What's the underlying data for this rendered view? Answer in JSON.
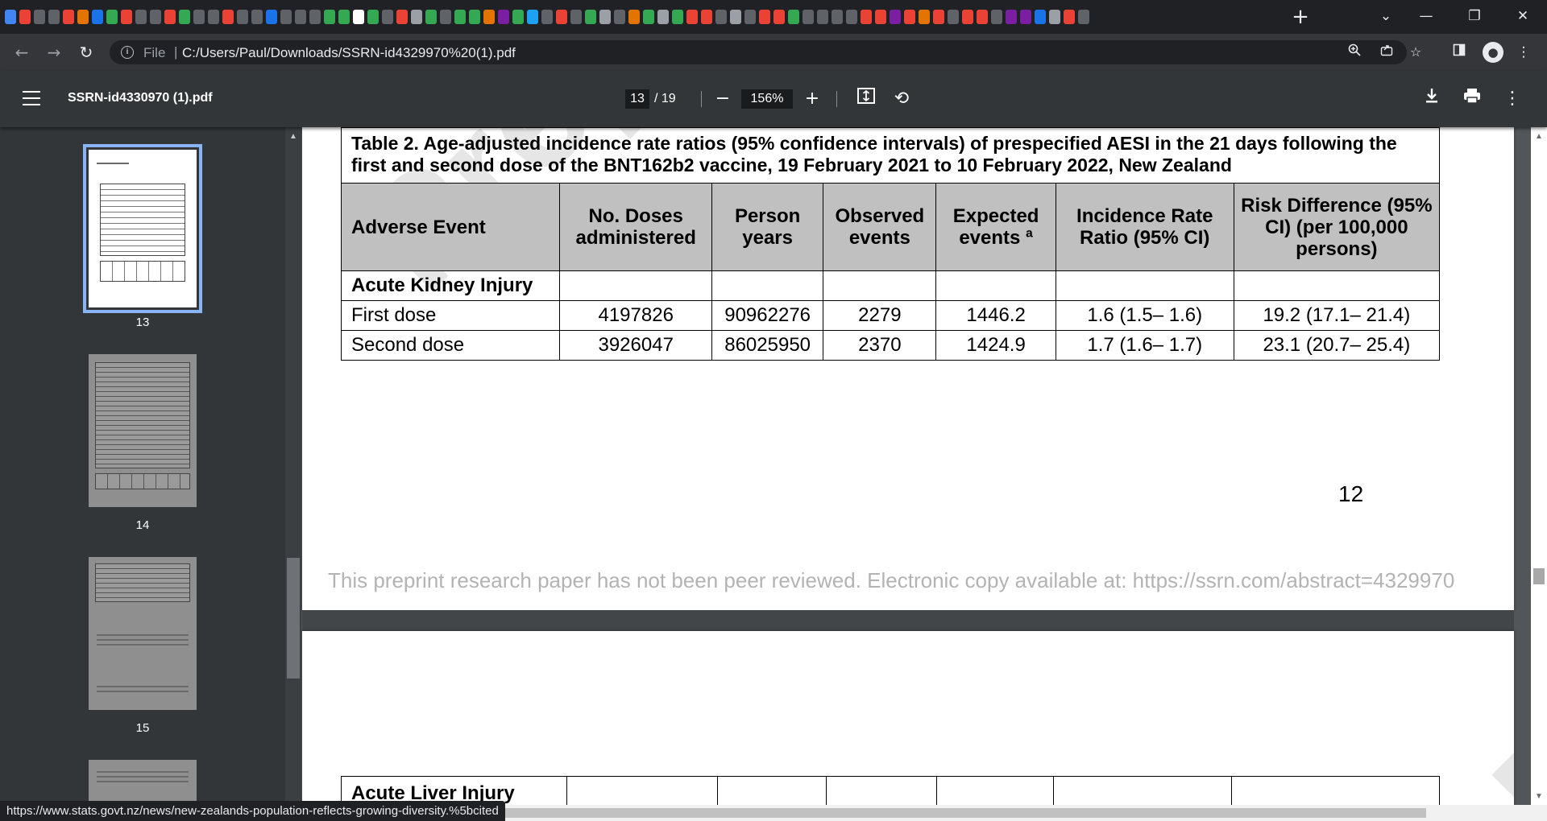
{
  "browser": {
    "new_tab_label": "+",
    "window_controls": {
      "dropdown": "⌄",
      "minimize": "—",
      "restore": "❐",
      "close": "✕"
    },
    "nav": {
      "back": "←",
      "forward": "→",
      "reload": "↻"
    },
    "address": {
      "scheme_label": "File",
      "separator": "|",
      "url": "C:/Users/Paul/Downloads/SSRN-id4329970%20(1).pdf"
    },
    "tab_icon_colors": [
      "#4285f4",
      "#ea4335",
      "#5f6368",
      "#5f6368",
      "#ea4335",
      "#e37400",
      "#1a73e8",
      "#34a853",
      "#ea4335",
      "#5f6368",
      "#5f6368",
      "#ea4335",
      "#34a853",
      "#5f6368",
      "#5f6368",
      "#ea4335",
      "#5f6368",
      "#5f6368",
      "#1a73e8",
      "#5f6368",
      "#5f6368",
      "#5f6368",
      "#34a853",
      "#34a853",
      "#ffffff",
      "#34a853",
      "#5f6368",
      "#ea4335",
      "#9aa0a6",
      "#34a853",
      "#5f6368",
      "#34a853",
      "#34a853",
      "#e37400",
      "#7b1fa2",
      "#34a853",
      "#1da1f2",
      "#5f6368",
      "#ea4335",
      "#5f6368",
      "#34a853",
      "#9aa0a6",
      "#5f6368",
      "#e37400",
      "#34a853",
      "#9aa0a6",
      "#34a853",
      "#ea4335",
      "#ea4335",
      "#5f6368",
      "#9aa0a6",
      "#5f6368",
      "#ea4335",
      "#ea4335",
      "#34a853",
      "#5f6368",
      "#5f6368",
      "#5f6368",
      "#5f6368",
      "#ea4335",
      "#ea4335",
      "#7b1fa2",
      "#ea4335",
      "#e37400",
      "#ea4335",
      "#5f6368",
      "#ea4335",
      "#ea4335",
      "#5f6368",
      "#7b1fa2",
      "#7b1fa2",
      "#1a73e8",
      "#9aa0a6",
      "#ea4335",
      "#5f6368"
    ],
    "status_url": "https://www.stats.govt.nz/news/new-zealands-population-reflects-growing-diversity.%5bcited"
  },
  "pdf_viewer": {
    "title": "SSRN-id4330970 (1).pdf",
    "current_page": "13",
    "total_pages": "/ 19",
    "zoom": "156%",
    "thumbnails": [
      {
        "page": "13",
        "active": true
      },
      {
        "page": "14",
        "active": false
      },
      {
        "page": "15",
        "active": false
      }
    ]
  },
  "document": {
    "watermark": "Preprint",
    "table_caption": "Table 2. Age-adjusted incidence rate ratios (95% confidence intervals) of prespecified AESI in the 21 days following the first and second dose of the BNT162b2 vaccine, 19 February 2021 to 10 February 2022, New Zealand",
    "headers": {
      "adverse_event": "Adverse Event",
      "doses": "No. Doses administered",
      "person_years": "Person years",
      "observed": "Observed events",
      "expected": "Expected events ª",
      "irr": "Incidence Rate Ratio (95% CI)",
      "risk_diff": "Risk Difference (95% CI) (per 100,000 persons)"
    },
    "group_label": "Acute Kidney Injury",
    "rows": [
      {
        "label": "First dose",
        "doses": "4197826",
        "person_years": "90962276",
        "observed": "2279",
        "expected": "1446.2",
        "irr": "1.6 (1.5– 1.6)",
        "risk_diff": "19.2 (17.1– 21.4)"
      },
      {
        "label": "Second dose",
        "doses": "3926047",
        "person_years": "86025950",
        "observed": "2370",
        "expected": "1424.9",
        "irr": "1.7 (1.6– 1.7)",
        "risk_diff": "23.1 (20.7– 25.4)"
      }
    ],
    "page_number": "12",
    "footer_note": "This preprint research paper has not been peer reviewed. Electronic copy available at: https://ssrn.com/abstract=4329970",
    "next_page_group": "Acute Liver Injury"
  }
}
